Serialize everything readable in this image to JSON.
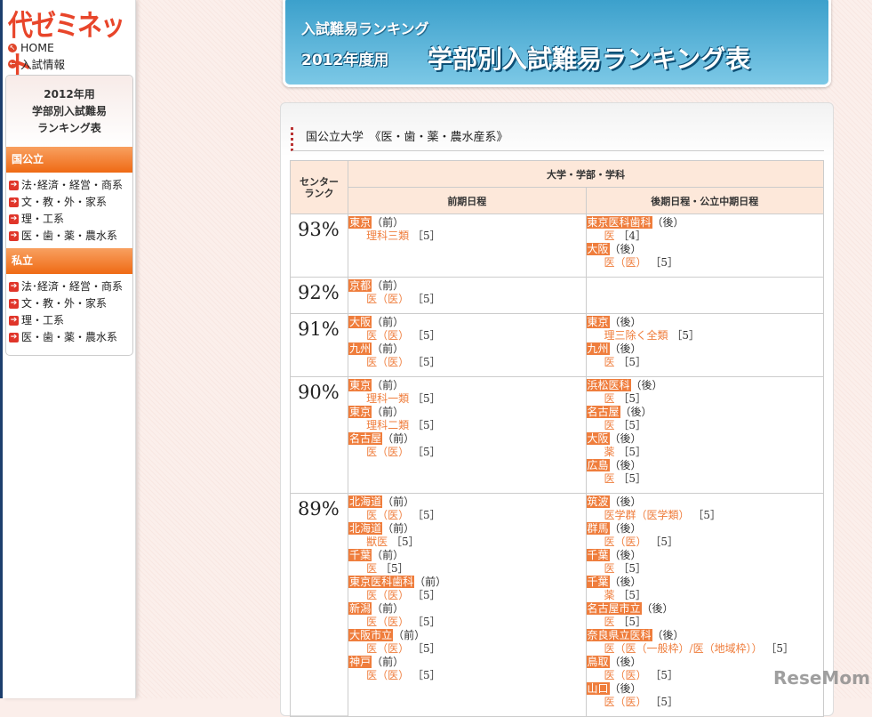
{
  "sidebar": {
    "logo": "代ゼミネット",
    "home": "HOME",
    "exam_info": "入試情報",
    "box_title": [
      "2012年用",
      "学部別入試難易",
      "ランキング表"
    ],
    "sections": [
      {
        "label": "国公立",
        "items": [
          "法･経済・経営・商系",
          "文・教・外・家系",
          "理・工系",
          "医・歯・薬・農水系"
        ]
      },
      {
        "label": "私立",
        "items": [
          "法･経済・経営・商系",
          "文・教・外・家系",
          "理・工系",
          "医・歯・薬・農水系"
        ]
      }
    ]
  },
  "banner": {
    "subtitle": "入試難易ランキング",
    "year": "2012年度用",
    "title": "学部別入試難易ランキング表"
  },
  "section_title": "国公立大学　《医・歯・薬・農水産系》",
  "table": {
    "h_rank": "センター\nランク",
    "h_group": "大学・学部・学科",
    "h_early": "前期日程",
    "h_late": "後期日程・公立中期日程",
    "rows": [
      {
        "rank": "93%",
        "early": [
          {
            "uni": "東京",
            "type": "（前）",
            "dept": "理科三類",
            "cap": "［5］"
          }
        ],
        "late": [
          {
            "uni": "東京医科歯科",
            "type": "（後）",
            "dept": "医",
            "cap": "［4］"
          },
          {
            "uni": "大阪",
            "type": "（後）",
            "dept": "医（医）",
            "cap": "［5］"
          }
        ]
      },
      {
        "rank": "92%",
        "early": [
          {
            "uni": "京都",
            "type": "（前）",
            "dept": "医（医）",
            "cap": "［5］"
          }
        ],
        "late": []
      },
      {
        "rank": "91%",
        "early": [
          {
            "uni": "大阪",
            "type": "（前）",
            "dept": "医（医）",
            "cap": "［5］"
          },
          {
            "uni": "九州",
            "type": "（前）",
            "dept": "医（医）",
            "cap": "［5］"
          }
        ],
        "late": [
          {
            "uni": "東京",
            "type": "（後）",
            "dept": "理三除く全類",
            "cap": "［5］"
          },
          {
            "uni": "九州",
            "type": "（後）",
            "dept": "医",
            "cap": "［5］"
          }
        ]
      },
      {
        "rank": "90%",
        "early": [
          {
            "uni": "東京",
            "type": "（前）",
            "dept": "理科一類",
            "cap": "［5］"
          },
          {
            "uni": "東京",
            "type": "（前）",
            "dept": "理科二類",
            "cap": "［5］"
          },
          {
            "uni": "名古屋",
            "type": "（前）",
            "dept": "医（医）",
            "cap": "［5］"
          }
        ],
        "late": [
          {
            "uni": "浜松医科",
            "type": "（後）",
            "dept": "医",
            "cap": "［5］"
          },
          {
            "uni": "名古屋",
            "type": "（後）",
            "dept": "医",
            "cap": "［5］"
          },
          {
            "uni": "大阪",
            "type": "（後）",
            "dept": "薬",
            "cap": "［5］"
          },
          {
            "uni": "広島",
            "type": "（後）",
            "dept": "医",
            "cap": "［5］"
          }
        ]
      },
      {
        "rank": "89%",
        "early": [
          {
            "uni": "北海道",
            "type": "（前）",
            "dept": "医（医）",
            "cap": "［5］"
          },
          {
            "uni": "北海道",
            "type": "（前）",
            "dept": "獣医",
            "cap": "［5］"
          },
          {
            "uni": "千葉",
            "type": "（前）",
            "dept": "医",
            "cap": "［5］"
          },
          {
            "uni": "東京医科歯科",
            "type": "（前）",
            "dept": "医（医）",
            "cap": "［5］"
          },
          {
            "uni": "新潟",
            "type": "（前）",
            "dept": "医（医）",
            "cap": "［5］"
          },
          {
            "uni": "大阪市立",
            "type": "（前）",
            "dept": "医（医）",
            "cap": "［5］"
          },
          {
            "uni": "神戸",
            "type": "（前）",
            "dept": "医（医）",
            "cap": "［5］"
          }
        ],
        "late": [
          {
            "uni": "筑波",
            "type": "（後）",
            "dept": "医学群（医学類）",
            "cap": "［5］"
          },
          {
            "uni": "群馬",
            "type": "（後）",
            "dept": "医（医）",
            "cap": "［5］"
          },
          {
            "uni": "千葉",
            "type": "（後）",
            "dept": "医",
            "cap": "［5］"
          },
          {
            "uni": "千葉",
            "type": "（後）",
            "dept": "薬",
            "cap": "［5］"
          },
          {
            "uni": "名古屋市立",
            "type": "（後）",
            "dept": "医",
            "cap": "［5］"
          },
          {
            "uni": "奈良県立医科",
            "type": "（後）",
            "dept": "医（医（一般枠）/医（地域枠））",
            "cap": "［5］"
          },
          {
            "uni": "鳥取",
            "type": "（後）",
            "dept": "医（医）",
            "cap": "［5］"
          },
          {
            "uni": "山口",
            "type": "（後）",
            "dept": "医（医）",
            "cap": "［5］"
          }
        ]
      }
    ]
  },
  "watermark": "ReseMom"
}
